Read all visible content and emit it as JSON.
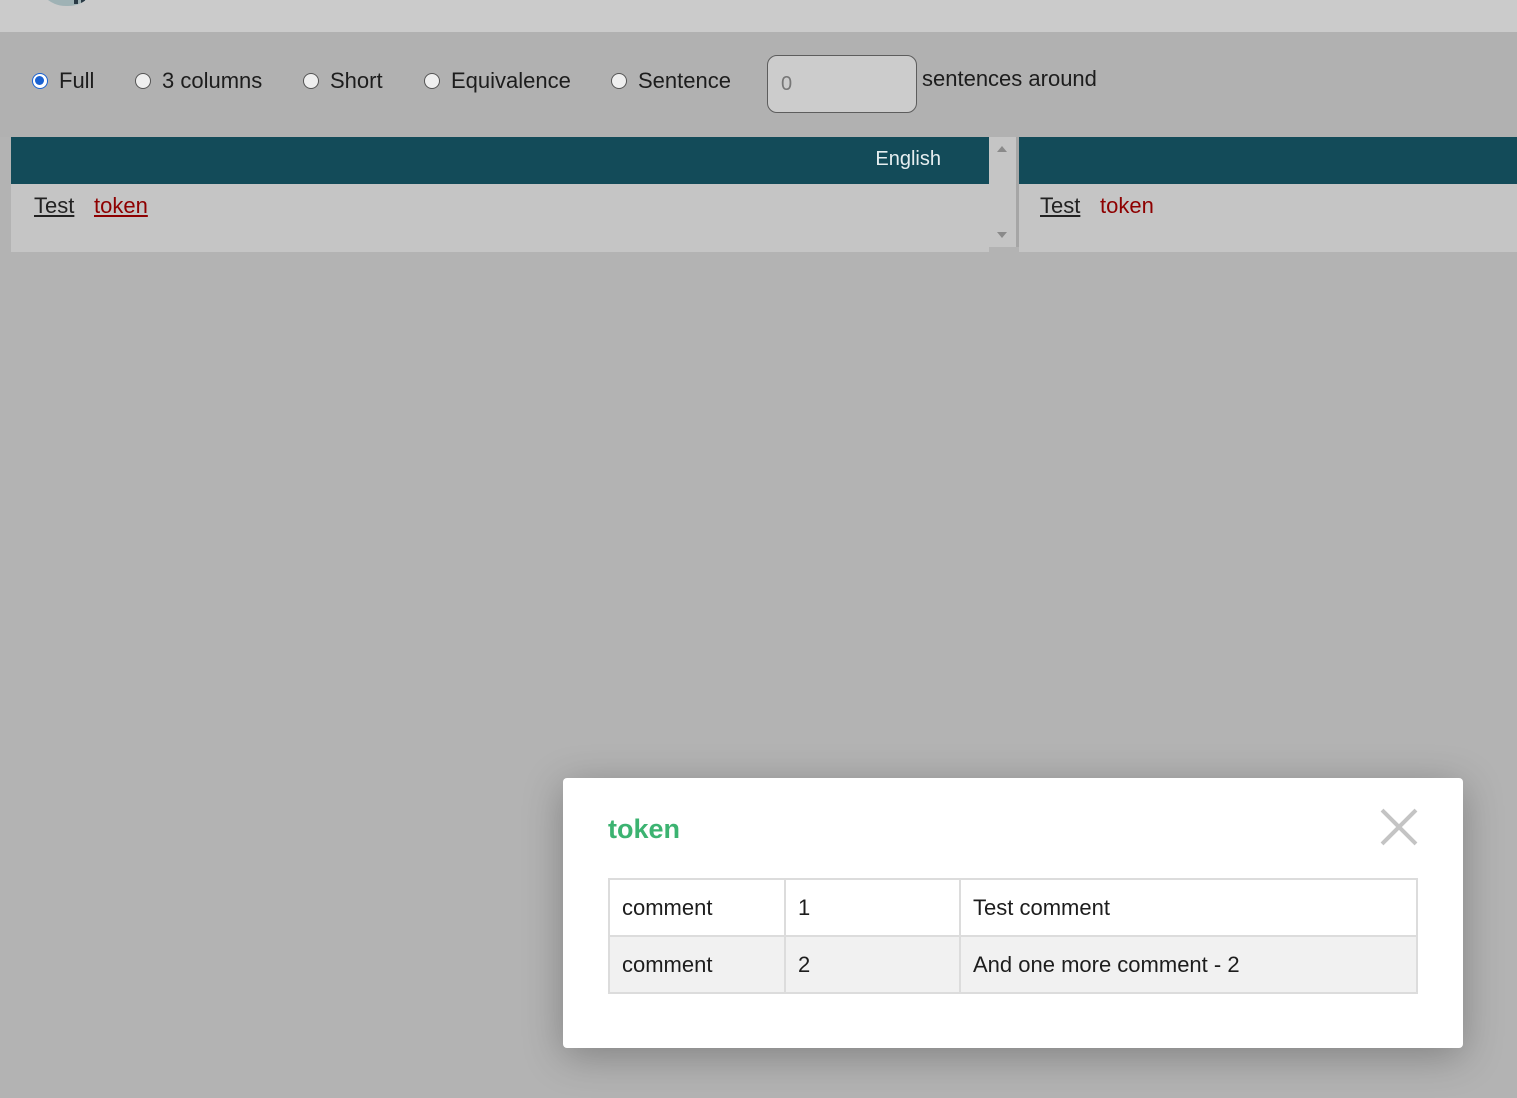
{
  "view_options": {
    "radios": [
      {
        "label": "Full",
        "checked": true
      },
      {
        "label": "3 columns",
        "checked": false
      },
      {
        "label": "Short",
        "checked": false
      },
      {
        "label": "Equivalence",
        "checked": false
      },
      {
        "label": "Sentence",
        "checked": false
      }
    ],
    "context_input_value": "0",
    "context_label": "sentences around"
  },
  "results": {
    "left_panel": {
      "language": "English",
      "tokens": [
        "Test",
        "token"
      ]
    },
    "right_panel": {
      "tokens": [
        "Test",
        "token"
      ]
    }
  },
  "popup": {
    "title": "token",
    "rows": [
      {
        "field": "comment",
        "id": "1",
        "value": "Test comment"
      },
      {
        "field": "comment",
        "id": "2",
        "value": "And one more comment - 2"
      }
    ]
  },
  "colors": {
    "header_bg": "#134b59",
    "token_highlight": "#8e0000",
    "popup_title": "#3cb371",
    "radio_accent": "#1a62d2"
  }
}
